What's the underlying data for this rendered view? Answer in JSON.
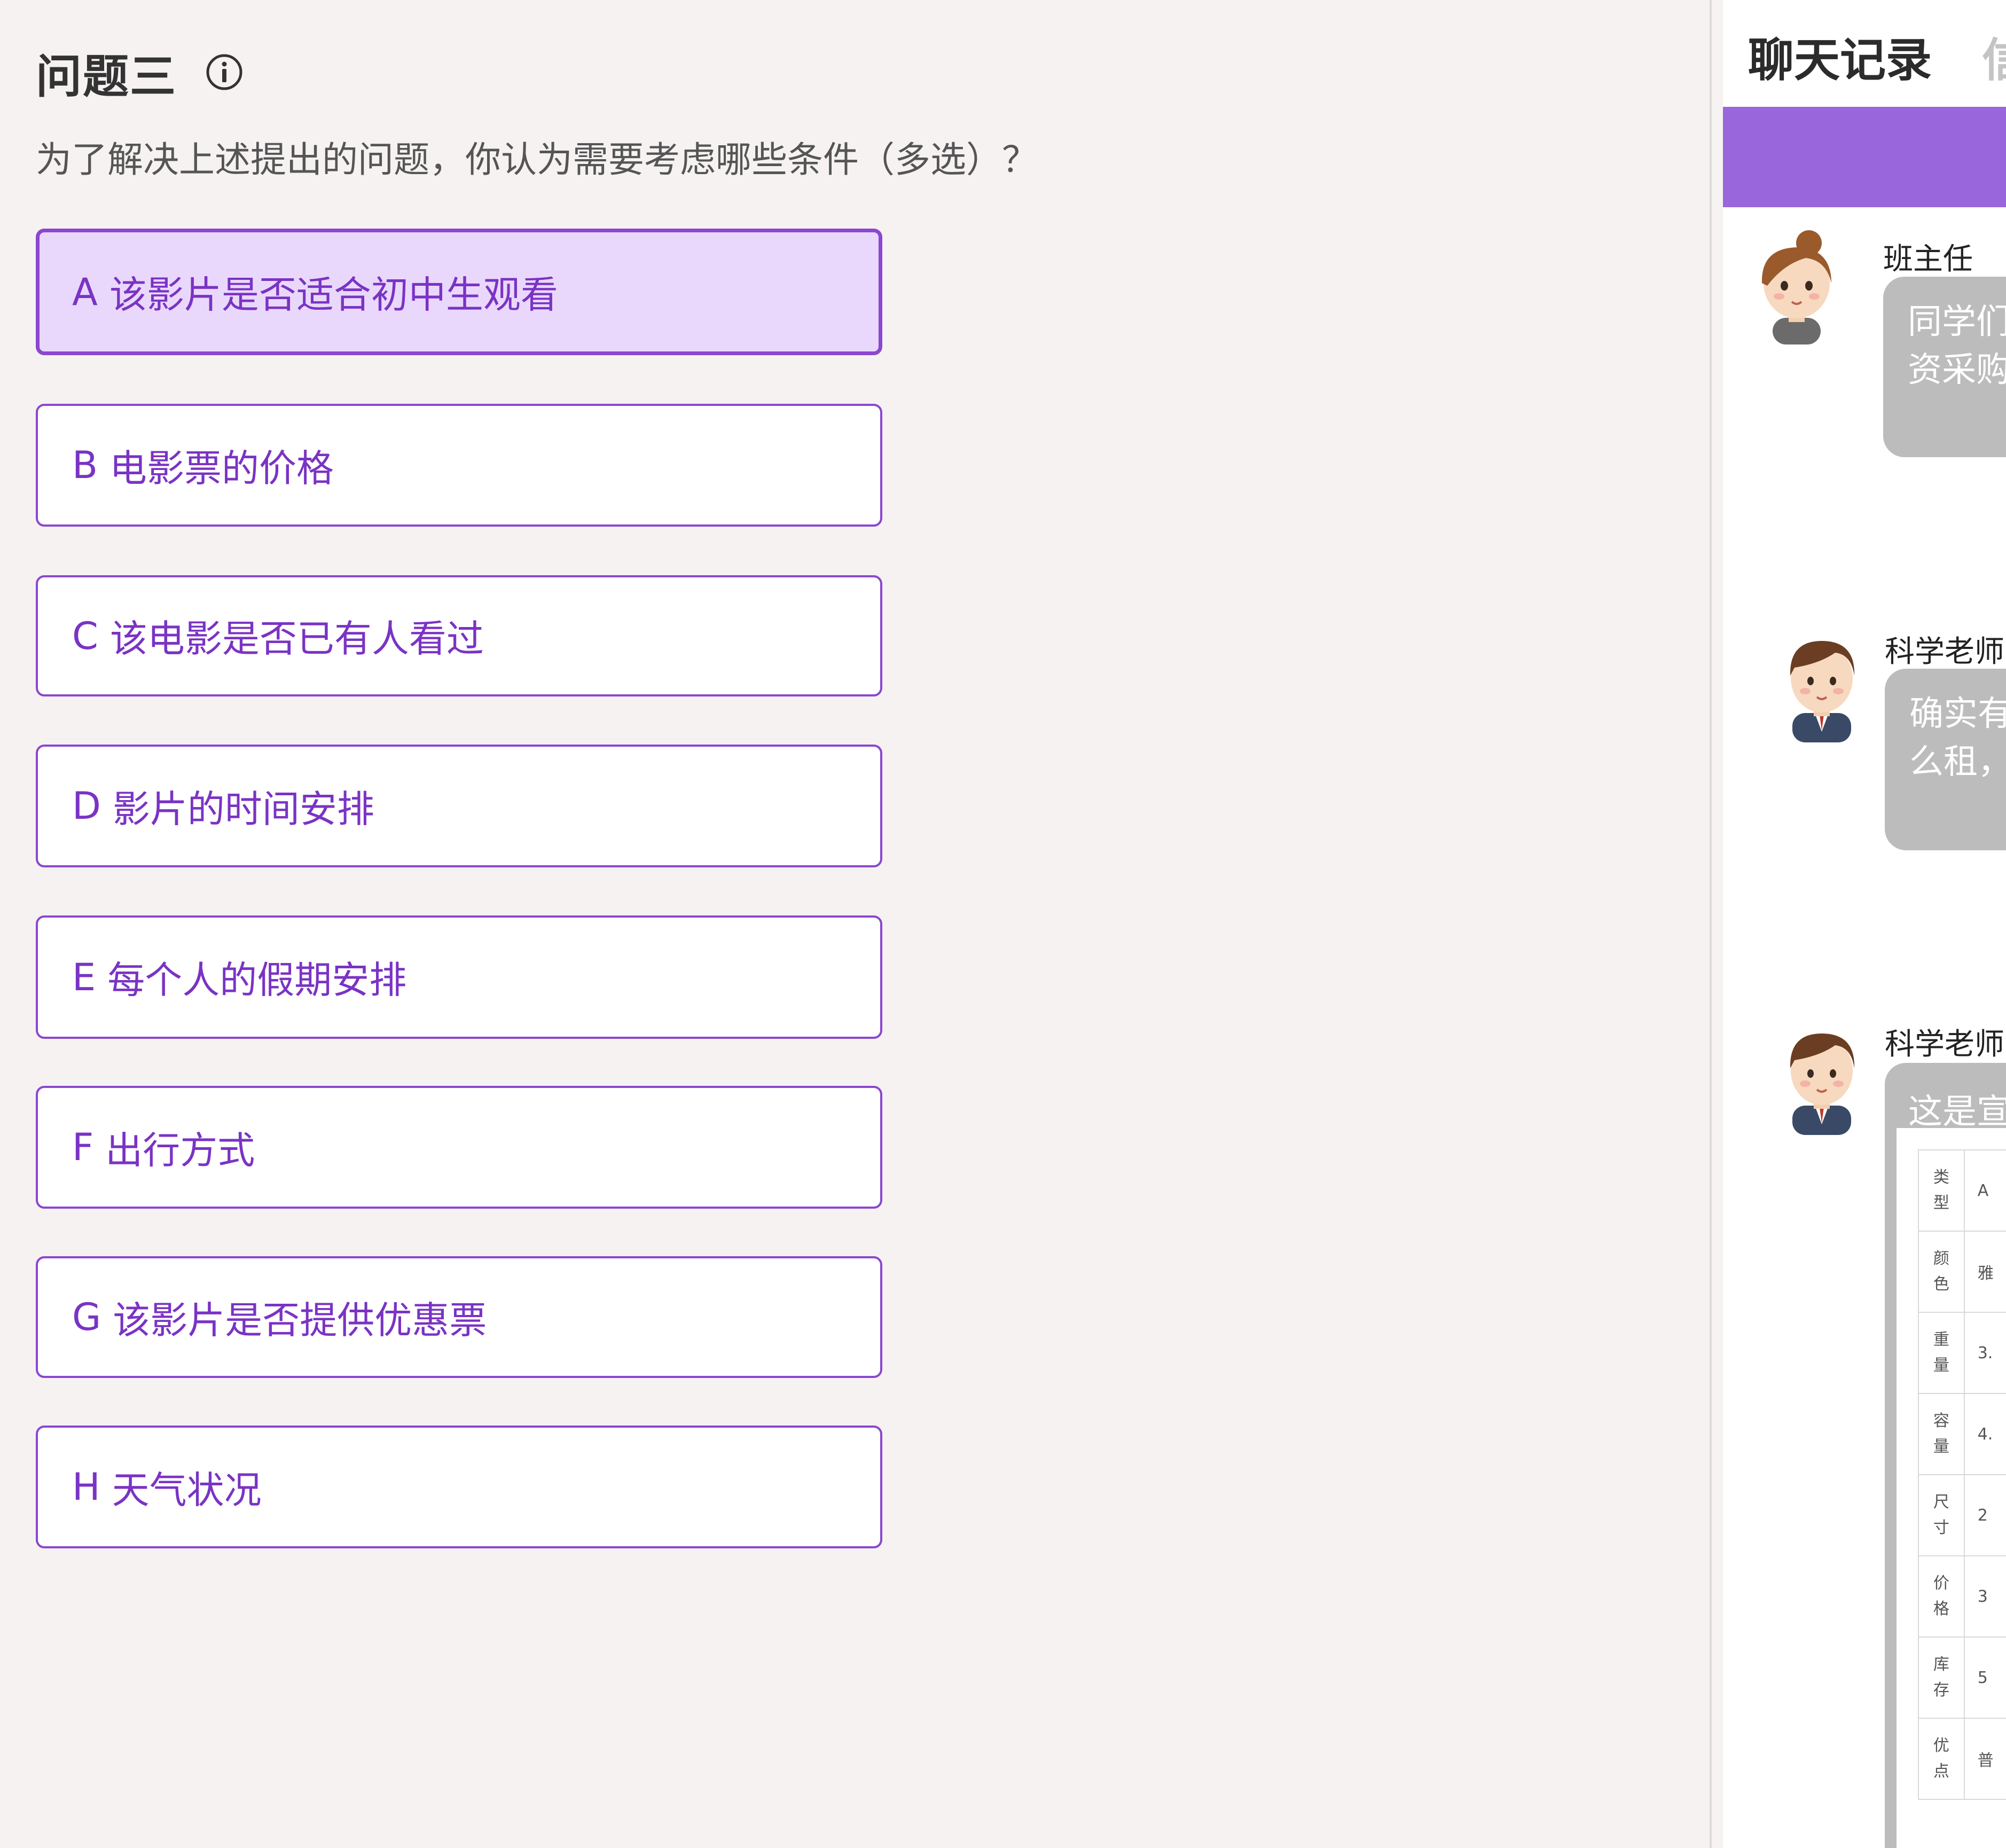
{
  "question": {
    "title": "问题三",
    "info_icon": "info-circle-icon",
    "prompt": "为了解决上述提出的问题，你认为需要考虑哪些条件（多选）？",
    "options": [
      {
        "letter": "A",
        "text": "该影片是否适合初中生观看",
        "selected": true
      },
      {
        "letter": "B",
        "text": "电影票的价格",
        "selected": false
      },
      {
        "letter": "C",
        "text": "该电影是否已有人看过",
        "selected": false
      },
      {
        "letter": "D",
        "text": "影片的时间安排",
        "selected": false
      },
      {
        "letter": "E",
        "text": "每个人的假期安排",
        "selected": false
      },
      {
        "letter": "F",
        "text": "出行方式",
        "selected": false
      },
      {
        "letter": "G",
        "text": "该影片是否提供优惠票",
        "selected": false
      },
      {
        "letter": "H",
        "text": "天气状况",
        "selected": false
      }
    ]
  },
  "chat": {
    "tabs": {
      "active": "聊天记录",
      "inactive_partial": "信"
    },
    "banner_color": "#9a66dc",
    "messages": [
      {
        "sender": "班主任",
        "avatar": "female-teacher-avatar-icon",
        "lines": [
          "同学们",
          "资采购"
        ]
      },
      {
        "sender": "科学老师",
        "avatar": "male-teacher-avatar-icon",
        "lines": [
          "确实有",
          "么租，"
        ]
      },
      {
        "sender": "科学老师",
        "avatar": "male-teacher-avatar-icon",
        "lines": [
          "这是宣"
        ]
      }
    ],
    "spec_table": [
      {
        "key": [
          "类",
          "型"
        ],
        "value": "A"
      },
      {
        "key": [
          "颜",
          "色"
        ],
        "value": "雅"
      },
      {
        "key": [
          "重",
          "量"
        ],
        "value": "3."
      },
      {
        "key": [
          "容",
          "量"
        ],
        "value": "4."
      },
      {
        "key": [
          "尺",
          "寸"
        ],
        "value": "2"
      },
      {
        "key": [
          "价",
          "格"
        ],
        "value": "3"
      },
      {
        "key": [
          "库",
          "存"
        ],
        "value": "5"
      },
      {
        "key": [
          "优",
          "点"
        ],
        "value": "普"
      }
    ]
  }
}
